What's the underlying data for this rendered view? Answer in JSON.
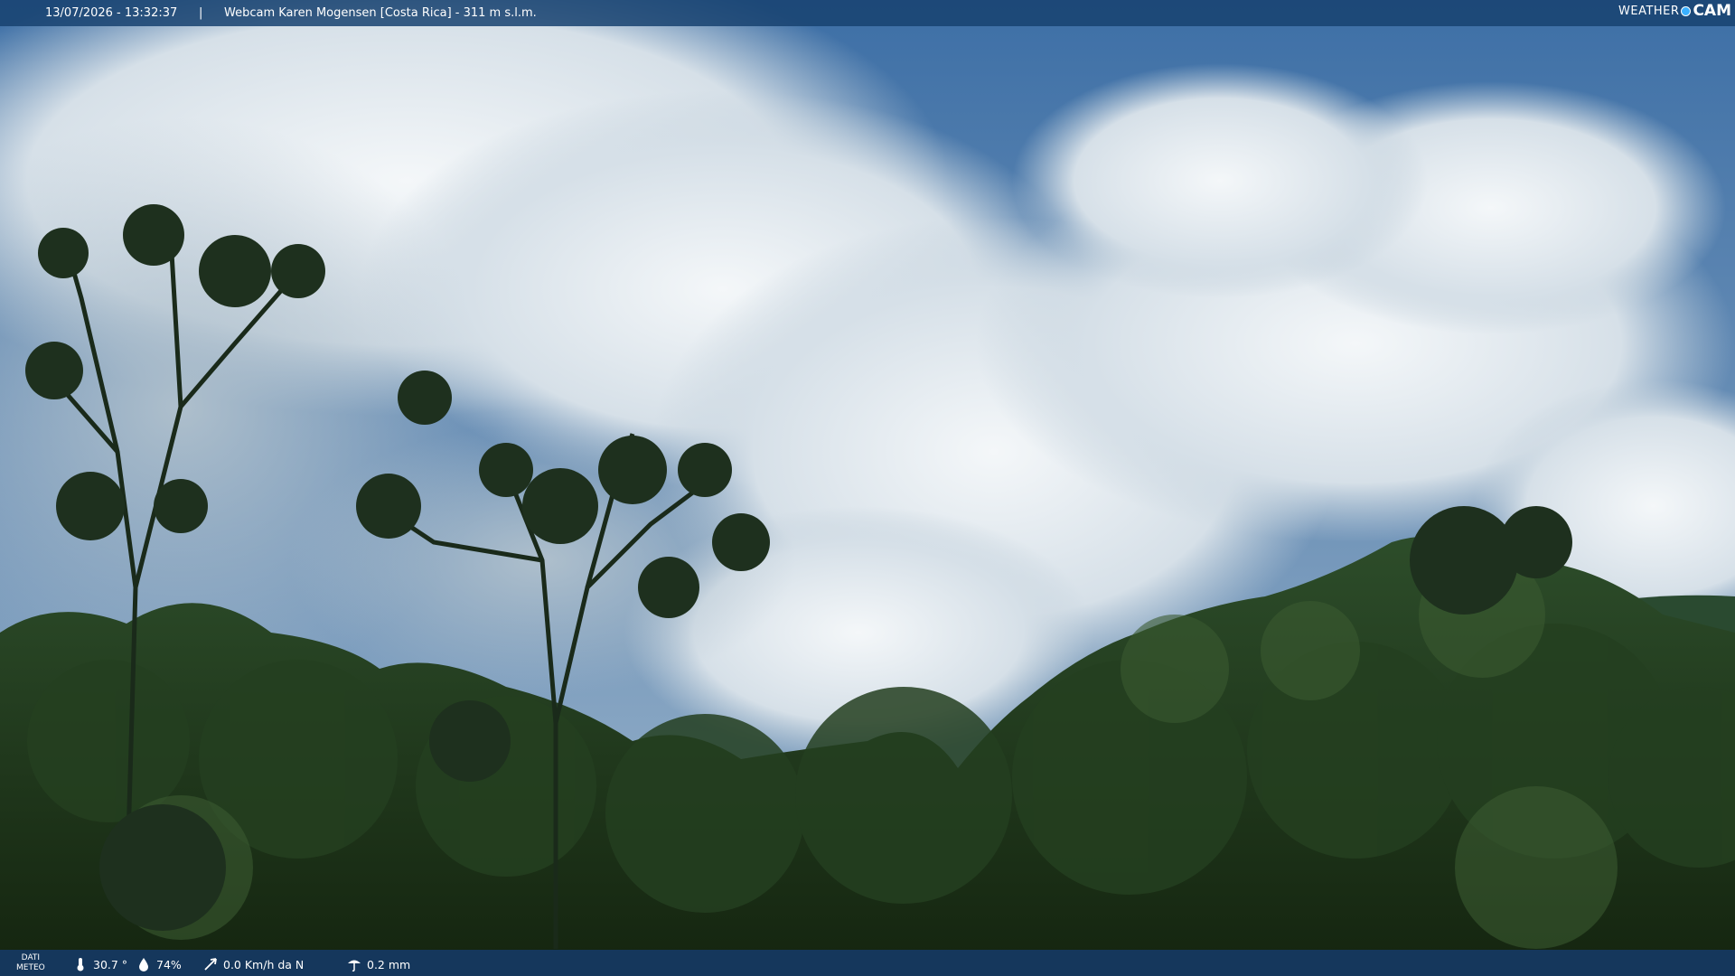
{
  "header": {
    "datetime": "13/07/2026 - 13:32:37",
    "separator": "|",
    "title": "Webcam Karen Mogensen [Costa Rica]  - 311 m s.l.m.",
    "logo_text_1": "WEATHER",
    "logo_text_2": "CAM"
  },
  "footer": {
    "label_line1": "DATI",
    "label_line2": "METEO",
    "temperature": "30.7 °",
    "humidity": "74%",
    "wind": "0.0 Km/h da N",
    "rain": "0.2 mm"
  },
  "icons": [
    "thermometer-icon",
    "humidity-icon",
    "wind-icon",
    "rain-icon"
  ],
  "colors": {
    "bar": "#184270",
    "sky": "#3a6fa8",
    "foliage": "#1c3a1c"
  }
}
